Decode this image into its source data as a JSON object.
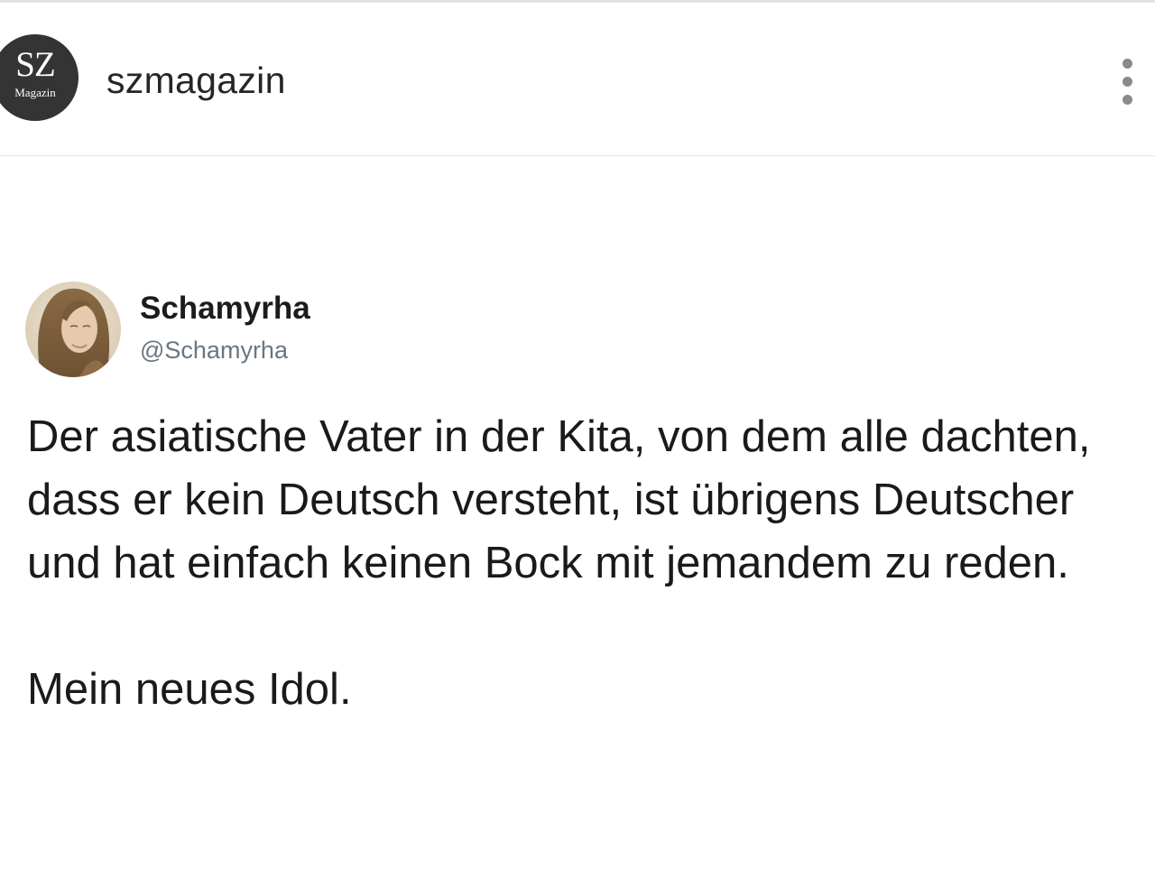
{
  "post": {
    "account": {
      "logo_text": "SZ",
      "logo_subtext": "Magazin",
      "username": "szmagazin"
    },
    "menu_icon": "more-vertical-icon"
  },
  "tweet": {
    "display_name": "Schamyrha",
    "handle": "@Schamyrha",
    "body": "Der asiatische Vater in der Kita, von dem alle dachten, dass er kein Deutsch versteht, ist übrigens Deutscher und hat einfach keinen Bock mit jemandem zu reden.",
    "closing": "Mein neues Idol."
  }
}
